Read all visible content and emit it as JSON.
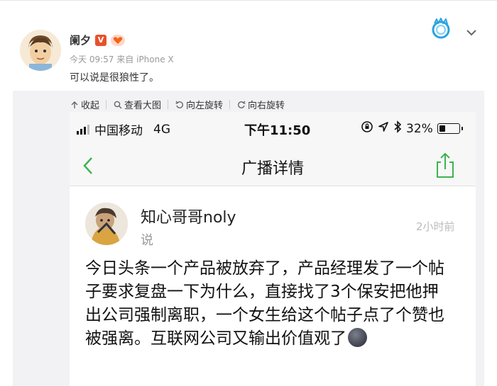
{
  "post": {
    "author": "阑夕",
    "v_badge": "V",
    "time": "今天 09:57",
    "source_prefix": "来自",
    "device": "iPhone X",
    "text": "可以说是很狼性了。"
  },
  "toolbar": {
    "items": [
      {
        "label": "收起",
        "icon": "collapse-icon"
      },
      {
        "label": "查看大图",
        "icon": "search-icon"
      },
      {
        "label": "向左旋转",
        "icon": "rotate-left-icon"
      },
      {
        "label": "向右旋转",
        "icon": "rotate-right-icon"
      }
    ]
  },
  "phone": {
    "carrier": "中国移动",
    "network": "4G",
    "clock": "下午11:50",
    "battery": "32%",
    "battery_level": 0.32,
    "nav_title": "广播详情",
    "accent": "#3fb34f"
  },
  "broadcast": {
    "user": "知心哥哥noly",
    "action": "说",
    "time": "2小时前",
    "body": "今日头条一个产品被放弃了，产品经理发了一个帖子要求复盘一下为什么，直接找了3个保安把他押出公司强制离职，一个女生给这个帖子点了个赞也被强离。互联网公司又输出价值观了"
  }
}
